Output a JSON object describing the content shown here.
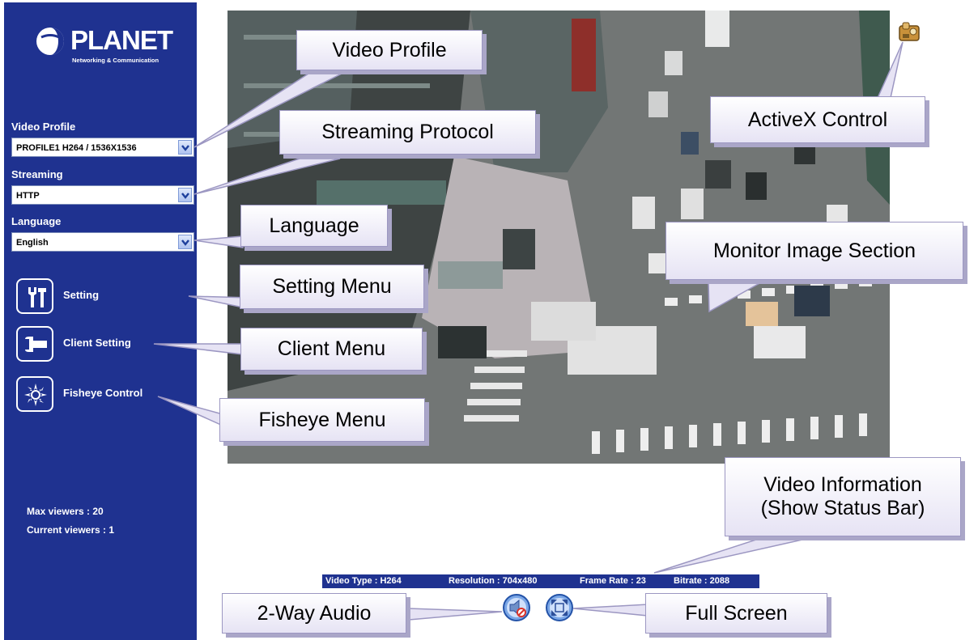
{
  "brand": {
    "name": "PLANET",
    "tagline": "Networking & Communication"
  },
  "sidebar": {
    "video_profile": {
      "label": "Video Profile",
      "value": "PROFILE1 H264 / 1536X1536"
    },
    "streaming": {
      "label": "Streaming",
      "value": "HTTP"
    },
    "language": {
      "label": "Language",
      "value": "English"
    },
    "menu": [
      {
        "label": "Setting",
        "icon": "tools-icon"
      },
      {
        "label": "Client Setting",
        "icon": "wrench-icon"
      },
      {
        "label": "Fisheye Control",
        "icon": "fisheye-icon"
      }
    ],
    "max_viewers": "Max viewers : 20",
    "current_viewers": "Current viewers : 1"
  },
  "status_bar": {
    "video_type": "Video Type : H264",
    "resolution": "Resolution : 704x480",
    "frame_rate": "Frame Rate : 23",
    "bitrate": "Bitrate : 2088"
  },
  "callouts": {
    "video_profile": "Video Profile",
    "streaming_protocol": "Streaming Protocol",
    "language": "Language",
    "setting_menu": "Setting Menu",
    "client_menu": "Client Menu",
    "fisheye_menu": "Fisheye Menu",
    "activex_control": "ActiveX Control",
    "monitor_image_section": "Monitor Image Section",
    "video_info_line1": "Video Information",
    "video_info_line2": "(Show Status Bar)",
    "two_way_audio": "2-Way Audio",
    "full_screen": "Full Screen"
  },
  "colors": {
    "sidebar_bg": "#1f3290",
    "callout_fill": "#e6e3f4",
    "callout_border": "#9c97c2"
  }
}
